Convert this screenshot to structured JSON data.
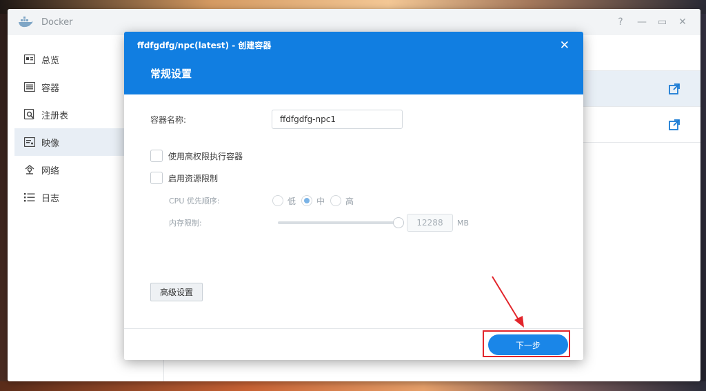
{
  "window": {
    "title": "Docker",
    "controls": {
      "help": "?",
      "minimize": "—",
      "maximize": "▭",
      "close": "✕"
    }
  },
  "sidebar": {
    "items": [
      {
        "label": "总览",
        "icon": "overview-icon",
        "active": false
      },
      {
        "label": "容器",
        "icon": "container-icon",
        "active": false
      },
      {
        "label": "注册表",
        "icon": "registry-icon",
        "active": false
      },
      {
        "label": "映像",
        "icon": "image-icon",
        "active": true
      },
      {
        "label": "网络",
        "icon": "network-icon",
        "active": false
      },
      {
        "label": "日志",
        "icon": "log-icon",
        "active": false
      }
    ]
  },
  "dialog": {
    "title": "ffdfgdfg/npc(latest) - 创建容器",
    "close": "✕",
    "subtitle": "常规设置",
    "container_name_label": "容器名称:",
    "container_name_value": "ffdfgdfg-npc1",
    "privileged_label": "使用高权限执行容器",
    "resource_limit_label": "启用资源限制",
    "cpu_priority_label": "CPU 优先顺序:",
    "cpu_options": [
      "低",
      "中",
      "高"
    ],
    "cpu_selected": "中",
    "memory_label": "内存限制:",
    "memory_value": "12288",
    "memory_unit": "MB",
    "advanced_button": "高级设置",
    "next_button": "下一步"
  },
  "colors": {
    "accent": "#117ee1",
    "button_primary": "#1a86e8",
    "annotation": "#e2252b"
  }
}
